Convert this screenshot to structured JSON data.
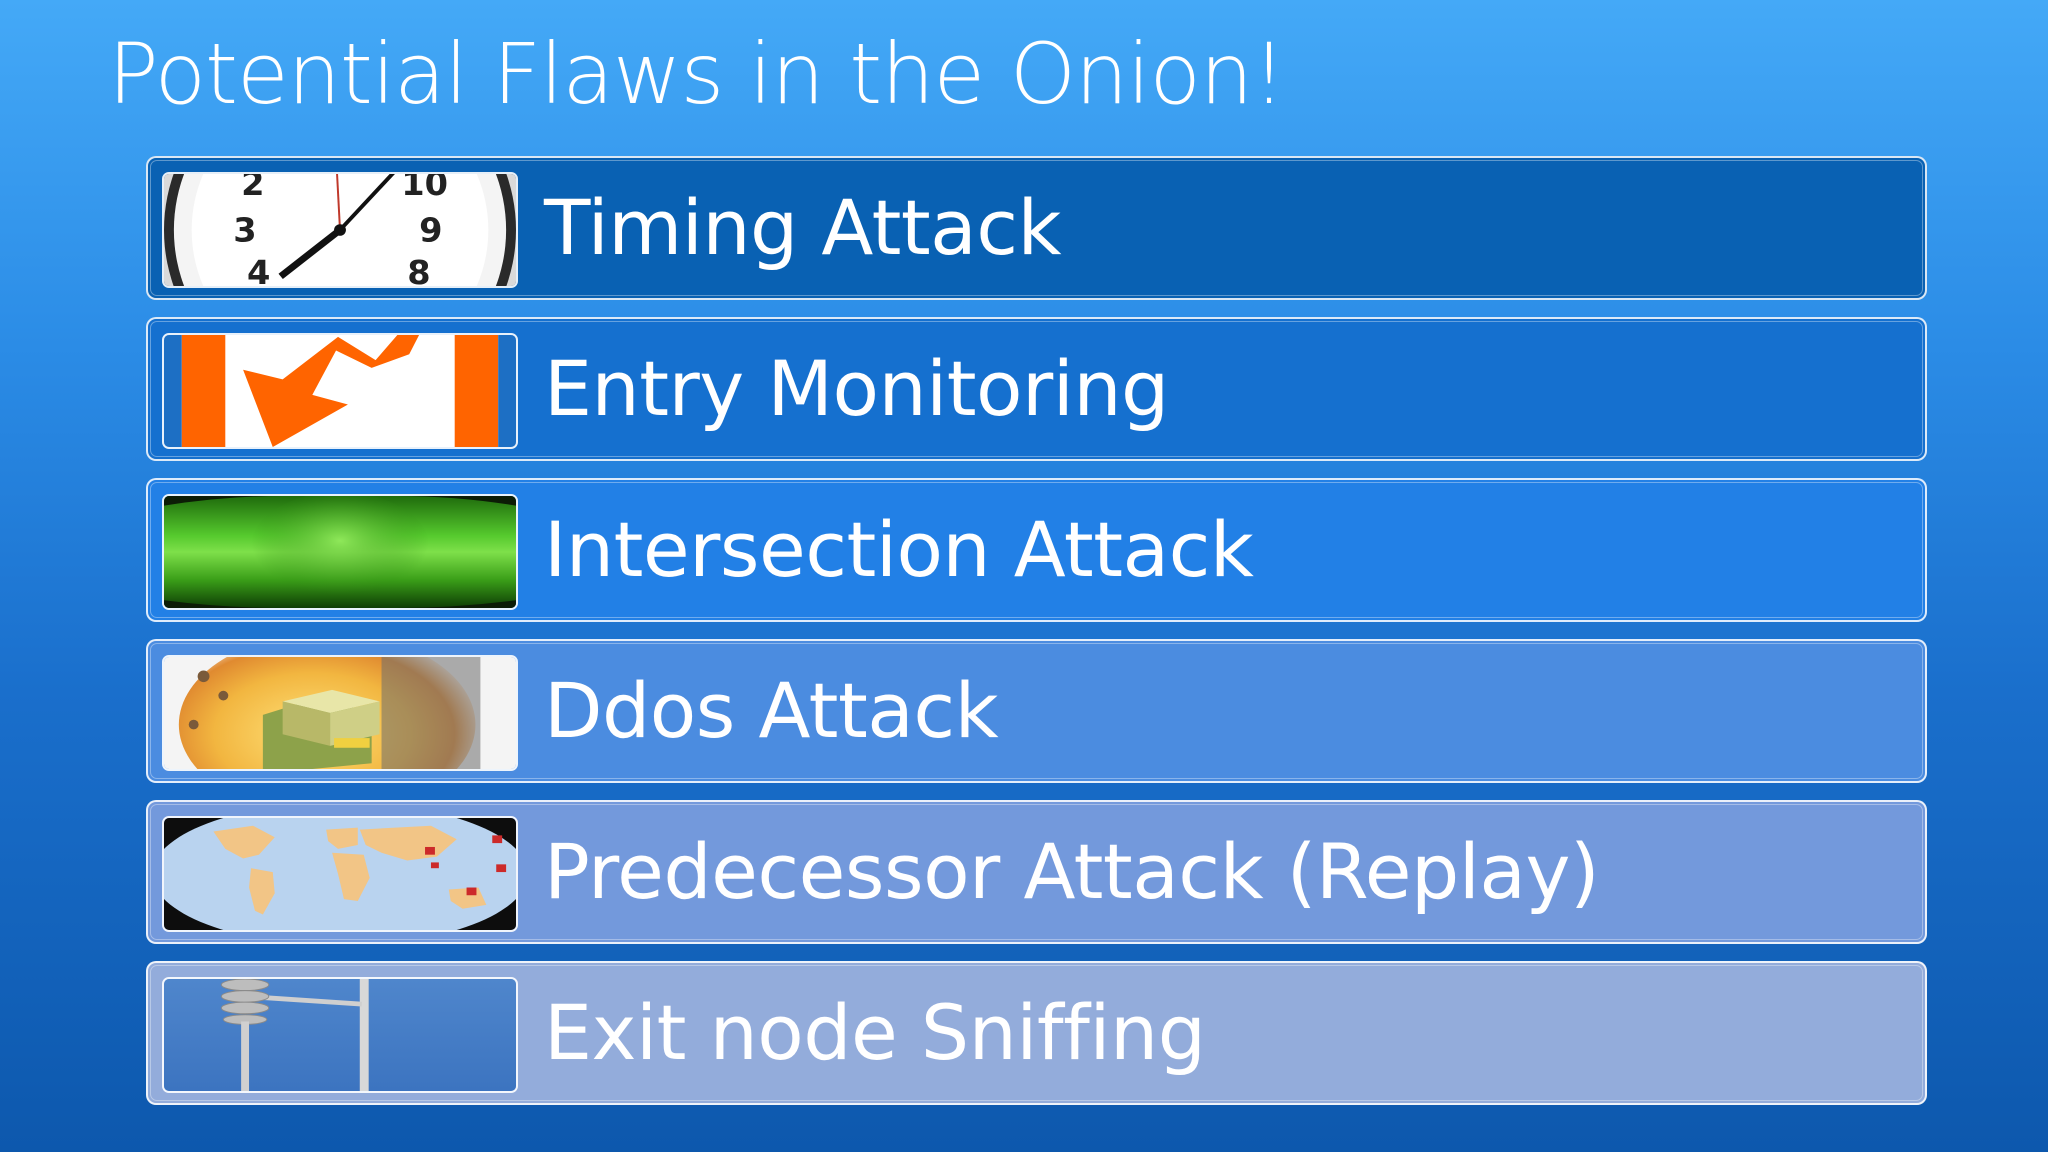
{
  "slide": {
    "title": "Potential Flaws in the Onion!"
  },
  "items": [
    {
      "label": "Timing Attack",
      "icon": "clock-icon",
      "bg": "#0961b3"
    },
    {
      "label": "Entry Monitoring",
      "icon": "entry-arrow-icon",
      "bg": "#1570cf"
    },
    {
      "label": "Intersection Attack",
      "icon": "green-intersection-icon",
      "bg": "#2280e6"
    },
    {
      "label": "Ddos Attack",
      "icon": "ddos-server-icon",
      "bg": "#4b8ce0"
    },
    {
      "label": "Predecessor Attack (Replay)",
      "icon": "world-map-icon",
      "bg": "#7399dc"
    },
    {
      "label": "Exit node Sniffing",
      "icon": "antenna-pole-icon",
      "bg": "#93acdb"
    }
  ]
}
